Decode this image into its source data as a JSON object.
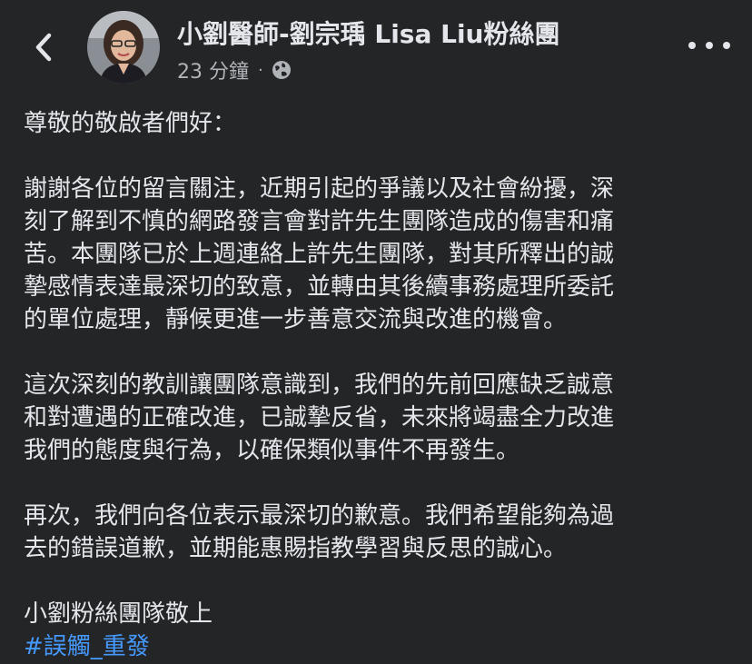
{
  "header": {
    "page_name": "小劉醫師-劉宗瑀 Lisa Liu粉絲團",
    "timestamp": "23 分鐘",
    "separator": "·",
    "audience_icon": "globe-icon",
    "back_icon": "chevron-left-icon",
    "more_icon": "more-horizontal-icon"
  },
  "post": {
    "greeting": "尊敬的敬啟者們好：",
    "paragraph_1": "謝謝各位的留言關注，近期引起的爭議以及社會紛擾，深\n刻了解到不慎的網路發言會對許先生團隊造成的傷害和痛\n苦。本團隊已於上週連絡上許先生團隊，對其所釋出的誠\n摯感情表達最深切的致意，並轉由其後續事務處理所委託\n的單位處理，靜候更進一步善意交流與改進的機會。",
    "paragraph_2": "這次深刻的教訓讓團隊意識到，我們的先前回應缺乏誠意\n和對遭遇的正確改進，已誠摯反省，未來將竭盡全力改進\n我們的態度與行為，以確保類似事件不再發生。",
    "paragraph_3": "再次，我們向各位表示最深切的歉意。我們希望能夠為過\n去的錯誤道歉，並期能惠賜指教學習與反思的誠心。",
    "signature": "小劉粉絲團隊敬上",
    "hashtag": "#誤觸_重發"
  },
  "colors": {
    "background": "#242526",
    "text_primary": "#e4e6eb",
    "text_secondary": "#b0b3b8",
    "link": "#4599ff"
  }
}
